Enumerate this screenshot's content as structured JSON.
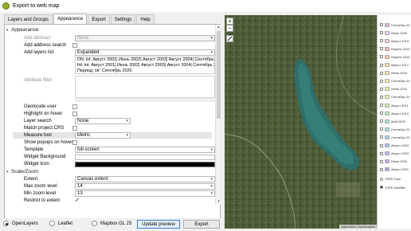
{
  "window": {
    "title": "Export to web map"
  },
  "tabs": [
    "Layers and Groups",
    "Appearance",
    "Export",
    "Settings",
    "Help"
  ],
  "appearance": {
    "group_label": "Appearance",
    "add_abstract": {
      "label": "Add abstract",
      "value": "None"
    },
    "add_address_search": {
      "label": "Add address search"
    },
    "add_layers_list": {
      "label": "Add layers list",
      "value": "Expanded"
    },
    "layers_list_text": [
      "DN: int: Август 2001| Июнь 2002| Август 2003| Август 2004| Сентябрь 2005",
      "fid: int: Август 2001| Июнь 2002| Август 2003| Август 2004| Сентябрь 2005",
      "Период: str: Сентябрь 2020"
    ],
    "attribute_filter": {
      "label": "Attribute filter"
    },
    "geolocate_user": {
      "label": "Geolocate user"
    },
    "highlight_on_hover": {
      "label": "Highlight on hover"
    },
    "layer_search": {
      "label": "Layer search",
      "value": "None"
    },
    "match_project_crs": {
      "label": "Match project CRS"
    },
    "measure_tool": {
      "label": "Measure tool",
      "value": "Metric"
    },
    "show_popups_on_hover": {
      "label": "Show popups on hover"
    },
    "template": {
      "label": "Template",
      "value": "full-screen"
    },
    "widget_background": {
      "label": "Widget Background",
      "color": "#ffffff"
    },
    "widget_icon": {
      "label": "Widget Icon",
      "color": "#000000"
    }
  },
  "scale_zoom": {
    "group_label": "Scale/Zoom",
    "extent": {
      "label": "Extent",
      "value": "Canvas extent"
    },
    "max_zoom": {
      "label": "Max zoom level",
      "value": "14"
    },
    "min_zoom": {
      "label": "Min zoom level",
      "value": "13"
    },
    "restrict_to_extent": {
      "label": "Restrict to extent",
      "checked": true,
      "mark": "✓"
    }
  },
  "bottom": {
    "formats": [
      {
        "label": "OpenLayers",
        "selected": true
      },
      {
        "label": "Leaflet",
        "selected": false
      },
      {
        "label": "Mapbox GL JS",
        "selected": false
      }
    ],
    "update_preview": "Update preview",
    "export": "Export"
  },
  "map": {
    "zoom_in": "+",
    "zoom_out": "−",
    "attribution": "Qgis2web | OpenLayers"
  },
  "legend": {
    "items": [
      {
        "label": "Сентябрь 20",
        "color": "#d9b3d9",
        "checked": false
      },
      {
        "label": "Июнь 2020",
        "color": "#e6ccff",
        "checked": false
      },
      {
        "label": "Август 2019",
        "color": "#ffcce0",
        "checked": false
      },
      {
        "label": "Апрель 2019",
        "color": "#ffb3b3",
        "checked": false
      },
      {
        "label": "Апрель 2018",
        "color": "#ffc9a3",
        "checked": false
      },
      {
        "label": "Август 2017",
        "color": "#ffd9a3",
        "checked": false
      },
      {
        "label": "Июнь 2016",
        "color": "#ffe6a3",
        "checked": false
      },
      {
        "label": "Сентябрь 20",
        "color": "#fff0a3",
        "checked": false
      },
      {
        "label": "Июнь 2014",
        "color": "#f5f5a3",
        "checked": false
      },
      {
        "label": "Сентябрь 20",
        "color": "#e0f5a3",
        "checked": false
      },
      {
        "label": "Август 2011",
        "color": "#c9f0a3",
        "checked": false
      },
      {
        "label": "Август 2010",
        "color": "#b3f0b3",
        "checked": false
      },
      {
        "label": "Май 2009",
        "color": "#a3e6c9",
        "checked": false
      },
      {
        "label": "Сентябрь 20",
        "color": "#a3e0e0",
        "checked": false
      },
      {
        "label": "Сентябрь 20",
        "color": "#a3d1f0",
        "checked": false
      },
      {
        "label": "Август 2004",
        "color": "#a3c2f5",
        "checked": false
      },
      {
        "label": "Август 2003",
        "color": "#b3b3f5",
        "checked": false
      },
      {
        "label": "Июнь 2002",
        "color": "#c2a3f0",
        "checked": false
      },
      {
        "label": "Август 2001",
        "color": "#a9a3e0",
        "checked": false
      }
    ],
    "basemaps": [
      {
        "label": "ESRI Topo",
        "selected": false
      },
      {
        "label": "ESRI Satellite",
        "selected": true
      }
    ]
  }
}
